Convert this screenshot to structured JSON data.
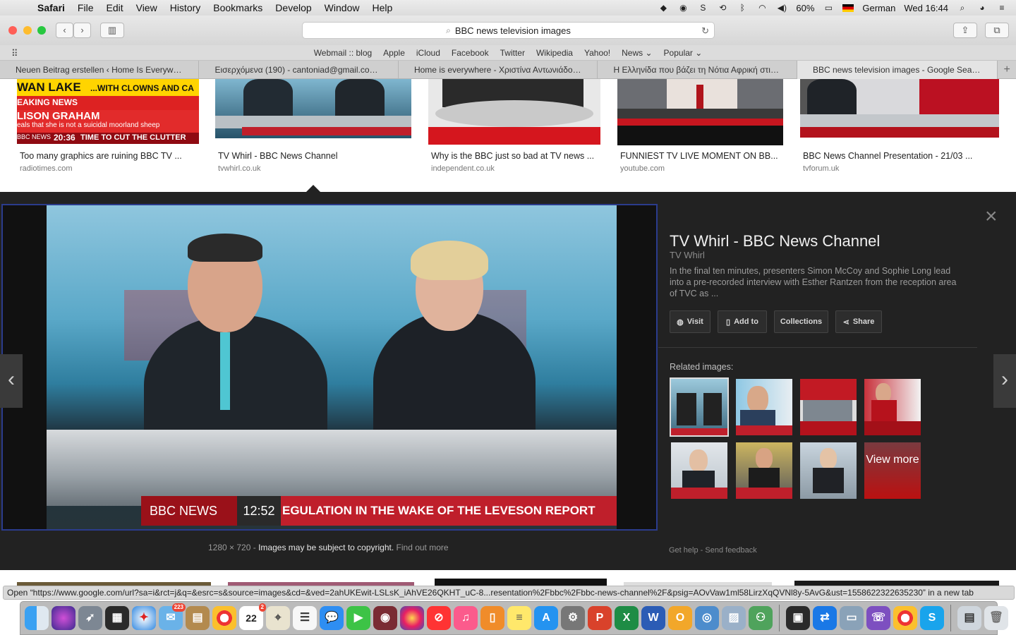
{
  "menubar": {
    "apple_icon": "apple-icon",
    "app_name": "Safari",
    "menus": [
      "File",
      "Edit",
      "View",
      "History",
      "Bookmarks",
      "Develop",
      "Window",
      "Help"
    ],
    "status": {
      "battery": "60%",
      "input_source": "German",
      "clock": "Wed 16:44"
    }
  },
  "toolbar": {
    "address": "BBC news television images"
  },
  "favorites": [
    "Webmail :: blog",
    "Apple",
    "iCloud",
    "Facebook",
    "Twitter",
    "Wikipedia",
    "Yahoo!",
    "News ⌄",
    "Popular ⌄"
  ],
  "tabs": [
    {
      "label": "Neuen Beitrag erstellen ‹ Home Is Everywher..."
    },
    {
      "label": "Εισερχόμενα (190) - cantoniad@gmail.com -..."
    },
    {
      "label": "Home is everywhere - Χριστίνα Αντωνιάδου..."
    },
    {
      "label": "Η Ελληνίδα που βάζει τη Νότια Αφρική στις..."
    },
    {
      "label": "BBC news television images - Google Search"
    }
  ],
  "results": [
    {
      "title": "Too many graphics are ruining BBC TV ...",
      "site": "radiotimes.com"
    },
    {
      "title": "TV Whirl - BBC News Channel",
      "site": "tvwhirl.co.uk"
    },
    {
      "title": "Why is the BBC just so bad at TV news ...",
      "site": "independent.co.uk"
    },
    {
      "title": "FUNNIEST TV LIVE MOMENT ON BB...",
      "site": "youtube.com"
    },
    {
      "title": "BBC News Channel Presentation - 21/03 ...",
      "site": "tvforum.uk"
    }
  ],
  "thumb1": {
    "line1": "WAN LAKE",
    "line1b": "...WITH CLOWNS AND CA",
    "line2": "EAKING NEWS",
    "line3": "LISON GRAHAM",
    "line4": "eals that she is not a suicidal moorland sheep",
    "bbc": "BBC NEWS",
    "time": "20:36",
    "ticker": "TIME TO CUT THE CLUTTER"
  },
  "viewer": {
    "title": "TV Whirl - BBC News Channel",
    "source": "TV Whirl",
    "description": "In the final ten minutes, presenters Simon McCoy and Sophie Long lead into a pre-recorded interview with Esther Rantzen from the reception area of TVC as ...",
    "buttons": {
      "visit": "Visit",
      "add_to": "Add to",
      "collections": "Collections",
      "share": "Share"
    },
    "related_label": "Related images:",
    "view_more": "View more",
    "dimensions": "1280 × 720",
    "copyright": "Images may be subject to copyright.",
    "find_out_more": "Find out more",
    "get_help": "Get help",
    "send_feedback": "Send feedback",
    "image_strap": {
      "bbc": "BBC NEWS",
      "time": "12:52",
      "ticker": "EGULATION IN THE WAKE OF THE LEVESON REPORT"
    }
  },
  "statusbar": {
    "text": "Open “https://www.google.com/url?sa=i&rct=j&q=&esrc=s&source=images&cd=&ved=2ahUKEwit-LSLsK_iAhVE26QKHT_uC-8...resentation%2Fbbc%2Fbbc-news-channel%2F&psig=AOvVaw1ml58LirzXqQVNl8y-5AvG&ust=1558622322635230” in a new tab"
  },
  "dock": {
    "badges": {
      "mail": "223",
      "calendar_day": "22",
      "calendar_badge": "2"
    }
  },
  "colors": {
    "bbc_red": "#bf1f2b",
    "viewer_bg": "#222222",
    "selection_border": "#2b3c8d"
  }
}
